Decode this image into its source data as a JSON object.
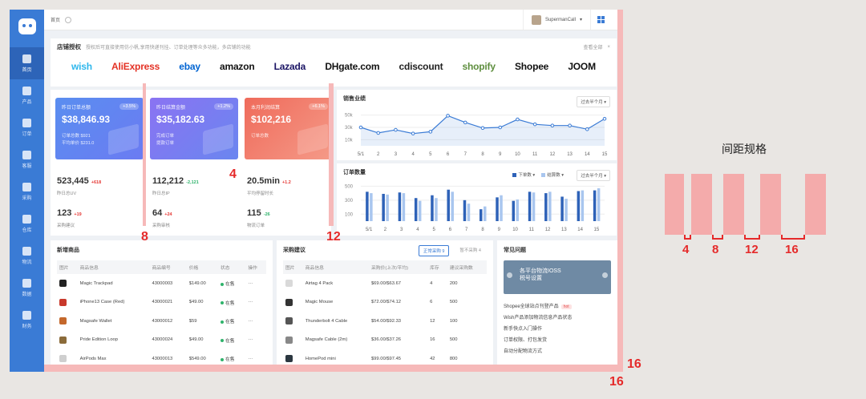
{
  "sidebar": {
    "items": [
      {
        "label": "首页"
      },
      {
        "label": "产品"
      },
      {
        "label": "订单"
      },
      {
        "label": "客服"
      },
      {
        "label": "采购"
      },
      {
        "label": "仓库"
      },
      {
        "label": "物流"
      },
      {
        "label": "数据"
      },
      {
        "label": "财务"
      }
    ]
  },
  "topbar": {
    "breadcrumb": "首页",
    "user": "SupermanCall"
  },
  "shop": {
    "title": "店铺授权",
    "desc": "授权后可直接使用仿小帆,享用快递刊挂、订单处理等众多功能，多店铺的功能",
    "view_all": "查看全部",
    "close": "×",
    "brands": [
      {
        "name": "wish",
        "color": "#2fb7ec"
      },
      {
        "name": "AliExpress",
        "color": "#e43225"
      },
      {
        "name": "ebay",
        "color": "#0064d2"
      },
      {
        "name": "amazon",
        "color": "#111111"
      },
      {
        "name": "Lazada",
        "color": "#1a1464"
      },
      {
        "name": "DHgate.com",
        "color": "#111111"
      },
      {
        "name": "cdiscount",
        "color": "#222222"
      },
      {
        "name": "shopify",
        "color": "#5e8e3e"
      },
      {
        "name": "Shopee",
        "color": "#111111"
      },
      {
        "name": "JOOM",
        "color": "#111111"
      }
    ]
  },
  "kpis": [
    {
      "label": "昨日订单总额",
      "value": "$38,846.93",
      "tag": "+3.5%",
      "sub1": "订单总数 $921",
      "sub2": "平均单价 $231.0",
      "from": "#5a8ef0",
      "to": "#6b7bf2"
    },
    {
      "label": "昨日结算金额",
      "value": "$35,182.63",
      "tag": "+1.2%",
      "sub1": "完成订单",
      "sub2": "提款订单",
      "from": "#8a73f2",
      "to": "#6a86f0"
    },
    {
      "label": "本月利润结算",
      "value": "$102,216",
      "tag": "+6.1%",
      "sub1": "订单总数",
      "sub2": "",
      "from": "#ef6b5b",
      "to": "#f59a88"
    }
  ],
  "stats": [
    {
      "value": "523,445",
      "delta": "+618",
      "delta_color": "#e53935",
      "label": "昨日总UV"
    },
    {
      "value": "112,212",
      "delta": "-2,121",
      "delta_color": "#2fb36b",
      "label": "昨日总IP"
    },
    {
      "value": "20.5min",
      "delta": "+1.2",
      "delta_color": "#e53935",
      "label": "平均停留时长"
    },
    {
      "value": "123",
      "delta": "+19",
      "delta_color": "#e53935",
      "label": "采购建议"
    },
    {
      "value": "64",
      "delta": "+24",
      "delta_color": "#e53935",
      "label": "采购审核"
    },
    {
      "value": "115",
      "delta": "-26",
      "delta_color": "#2fb36b",
      "label": "物流订单"
    }
  ],
  "sales": {
    "title": "销售业绩",
    "period": "过去半个月"
  },
  "orders": {
    "title": "订单数量",
    "period": "过去半个月",
    "legend": [
      "下单数",
      "结算数"
    ]
  },
  "chart_data": [
    {
      "type": "line",
      "title": "销售业绩",
      "x": [
        "5/1",
        "2",
        "3",
        "4",
        "5",
        "6",
        "7",
        "8",
        "9",
        "10",
        "11",
        "12",
        "13",
        "14",
        "15"
      ],
      "series": [
        {
          "values": [
            30,
            21,
            26,
            20,
            23,
            49,
            38,
            29,
            30,
            43,
            35,
            33,
            33,
            27,
            44
          ]
        }
      ],
      "yticks": [
        "50k",
        "30k",
        "10k"
      ],
      "ylim": [
        0,
        60
      ],
      "color": "#3a7bd5"
    },
    {
      "type": "bar",
      "title": "订单数量",
      "categories": [
        "5/1",
        "2",
        "3",
        "4",
        "5",
        "6",
        "7",
        "8",
        "9",
        "10",
        "11",
        "12",
        "13",
        "14",
        "15"
      ],
      "series": [
        {
          "name": "下单数",
          "values": [
            420,
            390,
            410,
            330,
            370,
            450,
            300,
            170,
            340,
            290,
            420,
            400,
            350,
            430,
            440
          ],
          "color": "#2e62b8"
        },
        {
          "name": "结算数",
          "values": [
            400,
            380,
            400,
            290,
            330,
            420,
            250,
            210,
            370,
            310,
            410,
            420,
            320,
            440,
            470
          ],
          "color": "#a9c6ef"
        }
      ],
      "yticks": [
        "500",
        "300",
        "100"
      ],
      "ylim": [
        0,
        550
      ]
    }
  ],
  "new_products": {
    "title": "新增商品",
    "headers": [
      "图片",
      "商品信息",
      "商品编号",
      "价格",
      "状态",
      "操作"
    ],
    "rows": [
      [
        "Magic Trackpad",
        "43000003",
        "$149.00",
        "在售",
        "···"
      ],
      [
        "iPhone13 Case (Red)",
        "43000021",
        "$49.00",
        "在售",
        "···"
      ],
      [
        "Magsafe Wallet",
        "43000012",
        "$59",
        "在售",
        "···"
      ],
      [
        "Pride Edition Loop",
        "43000024",
        "$49.00",
        "在售",
        "···"
      ],
      [
        "AirPods Max",
        "43000013",
        "$549.00",
        "在售",
        "···"
      ]
    ],
    "thumb_colors": [
      "#222222",
      "#c8392b",
      "#c4682c",
      "#8b6b3a",
      "#cfcfcf"
    ]
  },
  "purchase": {
    "title": "采购建议",
    "tab_on": "正常采购 9",
    "tab_off": "暂不采购 4",
    "headers": [
      "图片",
      "商品信息",
      "采购价(上次/平均)",
      "库存",
      "建议采购数"
    ],
    "rows": [
      [
        "Airtag 4 Pack",
        "$69.00/$63.67",
        "4",
        "200"
      ],
      [
        "Magic Mouse",
        "$72.00/$74.12",
        "6",
        "500"
      ],
      [
        "Thunderbolt 4 Cable",
        "$54.00/$92.33",
        "12",
        "100"
      ],
      [
        "Magsafe Cable (2m)",
        "$36.00/$37.26",
        "16",
        "500"
      ],
      [
        "HomePod mini",
        "$99.00/$97.45",
        "42",
        "800"
      ]
    ],
    "thumb_colors": [
      "#d9d9d9",
      "#333333",
      "#555555",
      "#888888",
      "#2b3740"
    ]
  },
  "faq": {
    "title": "常见问题",
    "banner_line1": "各平台物流IOSS",
    "banner_line2": "税号设置",
    "items": [
      "Shopee全球站点刊登产品",
      "Wish产品添加物流信息产品状态",
      "新手快点入门操作",
      "订单权限、打包发货",
      "自动分配物流方式"
    ],
    "hot": "hot"
  },
  "annotations": {
    "a4": "4",
    "a8": "8",
    "a12": "12",
    "a16a": "16",
    "a16b": "16"
  },
  "spec": {
    "title": "间距规格",
    "gaps": [
      "4",
      "8",
      "12",
      "16"
    ]
  }
}
